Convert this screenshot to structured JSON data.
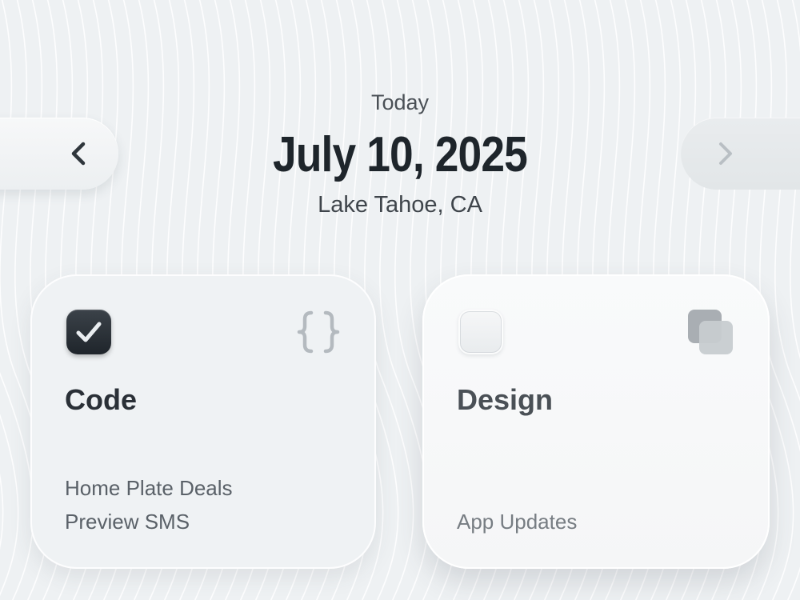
{
  "header": {
    "today_label": "Today",
    "date": "July 10, 2025",
    "location": "Lake Tahoe, CA"
  },
  "navigation": {
    "prev_icon": "chevron-left-icon",
    "next_icon": "chevron-right-icon",
    "next_enabled": false
  },
  "cards": [
    {
      "title": "Code",
      "checked": true,
      "icon": "curly-braces-icon",
      "items": [
        "Home Plate Deals",
        "Preview SMS"
      ]
    },
    {
      "title": "Design",
      "checked": false,
      "icon": "layers-icon",
      "items": [
        "App Updates"
      ]
    }
  ],
  "colors": {
    "background": "#eef1f3",
    "title_text": "#1e252b",
    "checkbox_checked": "#2a3037",
    "muted_icon": "#b4babf"
  }
}
